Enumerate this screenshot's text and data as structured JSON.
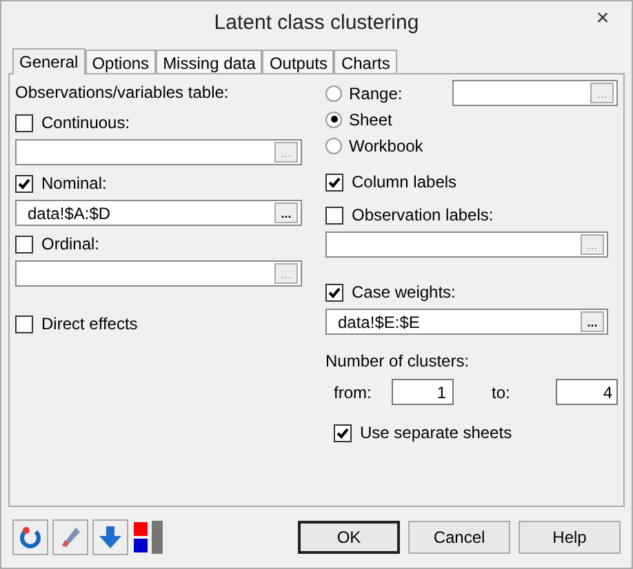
{
  "window": {
    "title": "Latent class clustering",
    "close": "×"
  },
  "tabs": [
    {
      "label": "General",
      "selected": true
    },
    {
      "label": "Options",
      "selected": false
    },
    {
      "label": "Missing data",
      "selected": false
    },
    {
      "label": "Outputs",
      "selected": false
    },
    {
      "label": "Charts",
      "selected": false
    }
  ],
  "left": {
    "heading": "Observations/variables table:",
    "inputs": [
      {
        "label": "Continuous:",
        "checked": false,
        "browse": "..."
      },
      {
        "label": "Nominal:",
        "checked": true,
        "value": "data!$A:$D",
        "browse": "..."
      },
      {
        "label": "Ordinal:",
        "checked": false,
        "browse": "..."
      }
    ],
    "direct_effects": {
      "label": "Direct effects",
      "checked": false
    }
  },
  "right": {
    "output_target": [
      {
        "label": "Range:",
        "selected": false
      },
      {
        "label": "Sheet",
        "selected": true
      },
      {
        "label": "Workbook",
        "selected": false
      }
    ],
    "range_browse": "...",
    "column_labels": {
      "label": "Column labels",
      "checked": true
    },
    "observation_labels": {
      "label": "Observation labels:",
      "checked": false,
      "browse": "..."
    },
    "case_weights": {
      "label": "Case weights:",
      "checked": true,
      "value": "data!$E:$E",
      "browse": "..."
    },
    "clusters": {
      "heading": "Number of clusters:",
      "from_label": "from:",
      "from": "1",
      "to_label": "to:",
      "to": "4"
    },
    "separate_sheets": {
      "label": "Use separate sheets",
      "checked": true
    }
  },
  "buttons": [
    "OK",
    "Cancel",
    "Help"
  ]
}
